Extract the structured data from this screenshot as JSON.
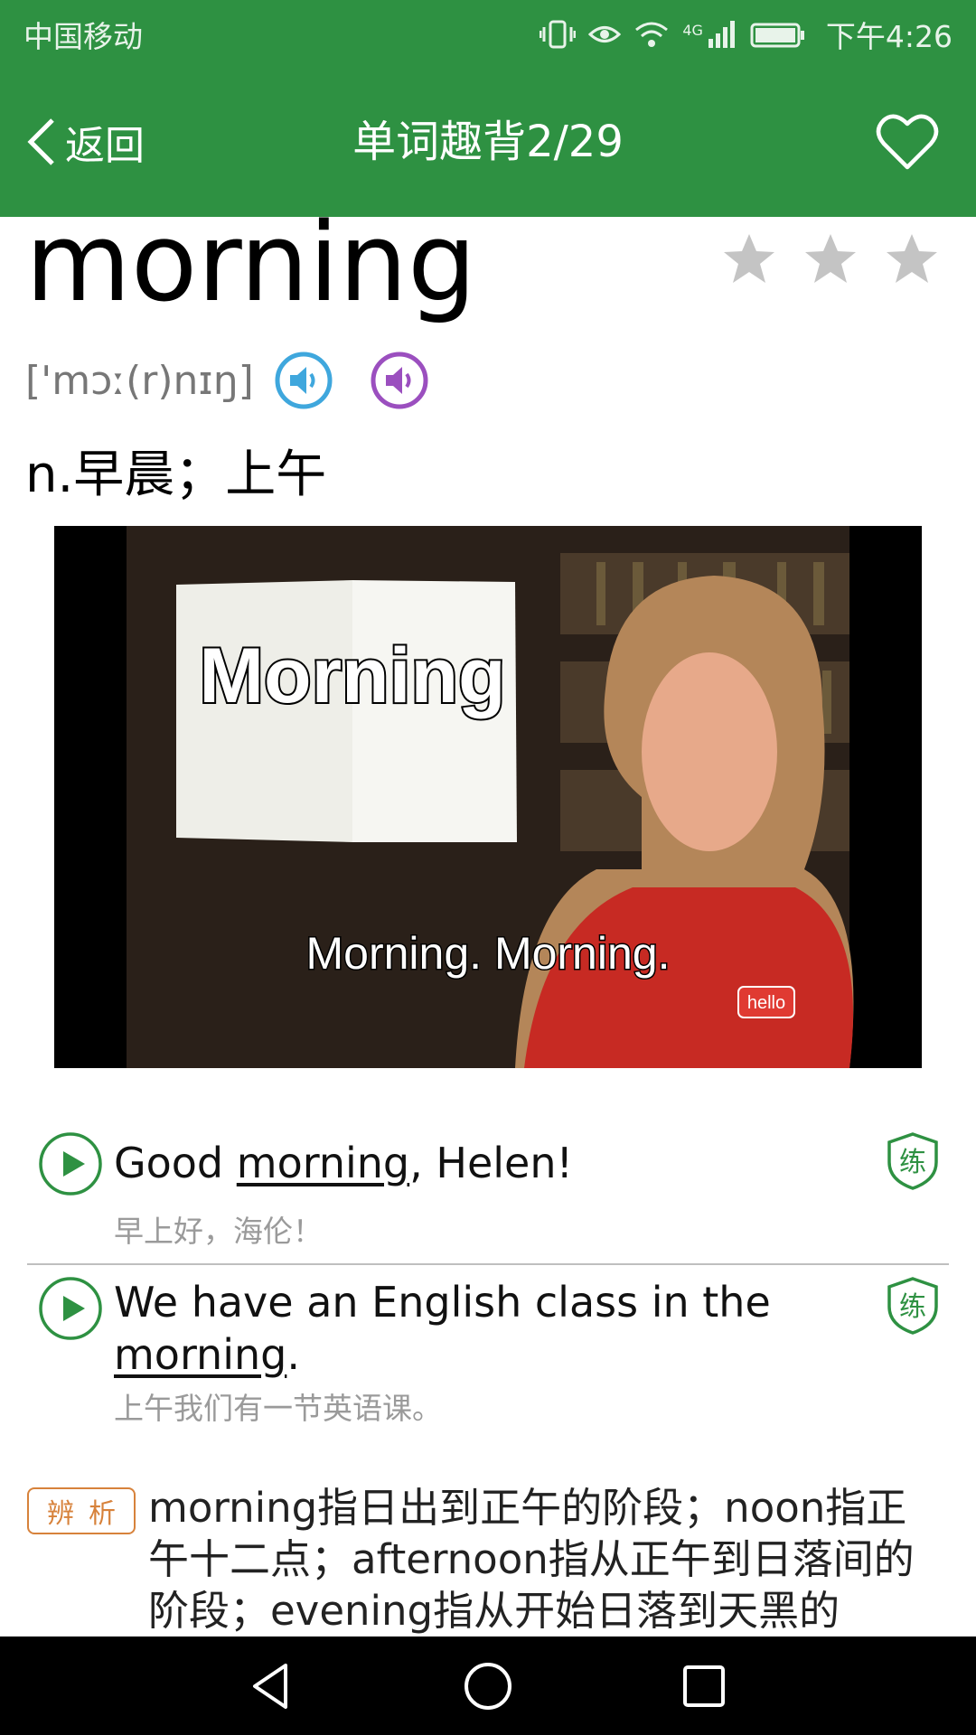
{
  "status_bar": {
    "carrier": "中国移动",
    "network": "4G",
    "time": "下午4:26"
  },
  "header": {
    "back_label": "返回",
    "title": "单词趣背2/29",
    "favorite_icon": "heart-outline-icon"
  },
  "word": {
    "text": "morning",
    "phonetic": "['mɔː(r)nɪŋ]",
    "definition": "n.早晨；上午",
    "star_rating": 0,
    "star_max": 3,
    "speaker_colors": [
      "#3fa7dd",
      "#9b4fbf"
    ]
  },
  "video": {
    "caption_board": "Morning",
    "caption_subtitle": "Morning.  Morning.",
    "logo_text": "hello"
  },
  "examples": [
    {
      "en_before": "Good ",
      "en_keyword": "morning",
      "en_after": ", Helen!",
      "zh": "早上好，海伦！",
      "practice_label": "练"
    },
    {
      "en_before": "We have an English class in the ",
      "en_keyword": "morning",
      "en_after": ".",
      "zh": "上午我们有一节英语课。",
      "practice_label": "练"
    }
  ],
  "analysis": {
    "badge": "辨析",
    "text": "morning指日出到正午的阶段；noon指正午十二点；afternoon指从正午到日落间的阶段；evening指从开始日落到天黑的"
  },
  "colors": {
    "brand_green": "#2e9142",
    "accent_orange": "#d7823b"
  }
}
